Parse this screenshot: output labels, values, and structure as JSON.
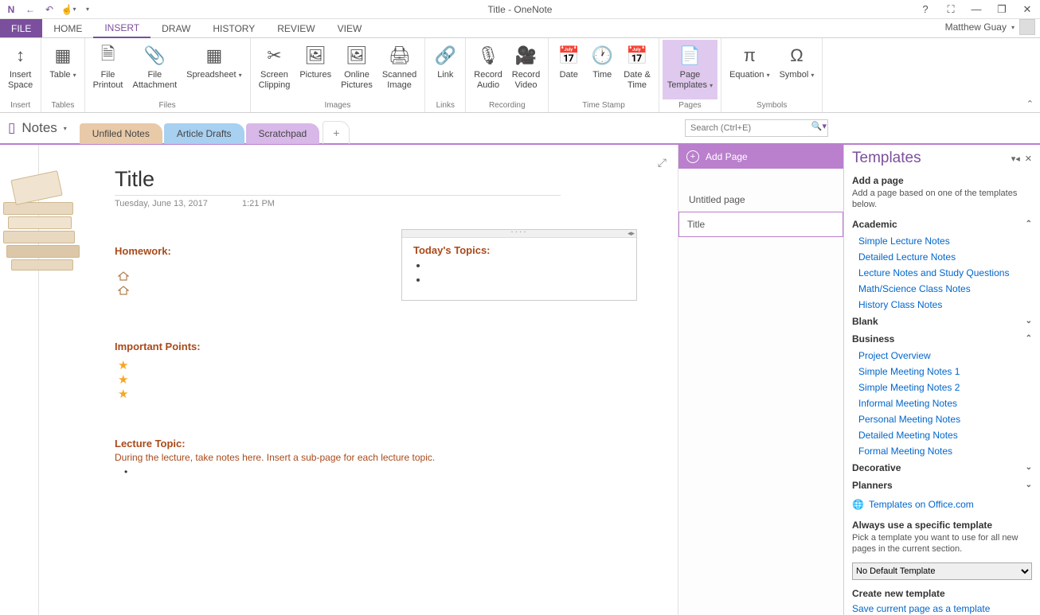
{
  "titlebar": {
    "title": "Title - OneNote"
  },
  "tabs": {
    "file": "FILE",
    "items": [
      "HOME",
      "INSERT",
      "DRAW",
      "HISTORY",
      "REVIEW",
      "VIEW"
    ],
    "activeIndex": 1,
    "user": "Matthew Guay"
  },
  "ribbon": {
    "groups": [
      {
        "label": "Insert",
        "items": [
          {
            "label": "Insert\nSpace"
          }
        ]
      },
      {
        "label": "Tables",
        "items": [
          {
            "label": "Table",
            "dd": true
          }
        ]
      },
      {
        "label": "Files",
        "items": [
          {
            "label": "File\nPrintout"
          },
          {
            "label": "File\nAttachment"
          },
          {
            "label": "Spreadsheet",
            "dd": true
          }
        ]
      },
      {
        "label": "Images",
        "items": [
          {
            "label": "Screen\nClipping"
          },
          {
            "label": "Pictures"
          },
          {
            "label": "Online\nPictures"
          },
          {
            "label": "Scanned\nImage"
          }
        ]
      },
      {
        "label": "Links",
        "items": [
          {
            "label": "Link"
          }
        ]
      },
      {
        "label": "Recording",
        "items": [
          {
            "label": "Record\nAudio"
          },
          {
            "label": "Record\nVideo"
          }
        ]
      },
      {
        "label": "Time Stamp",
        "items": [
          {
            "label": "Date"
          },
          {
            "label": "Time"
          },
          {
            "label": "Date &\nTime"
          }
        ]
      },
      {
        "label": "Pages",
        "items": [
          {
            "label": "Page\nTemplates",
            "dd": true,
            "active": true
          }
        ]
      },
      {
        "label": "Symbols",
        "items": [
          {
            "label": "Equation",
            "dd": true
          },
          {
            "label": "Symbol",
            "dd": true
          }
        ]
      }
    ]
  },
  "ribbon_icons": [
    "↕",
    "▦",
    "🗎",
    "📎",
    "▦",
    "✂",
    "🖼",
    "🖼",
    "🖨",
    "🔗",
    "🎙",
    "🎥",
    "📅",
    "🕐",
    "📅",
    "📄",
    "π",
    "Ω"
  ],
  "workspace": {
    "notebook": "Notes",
    "sections": [
      "Unfiled Notes",
      "Article Drafts",
      "Scratchpad"
    ],
    "search_placeholder": "Search (Ctrl+E)"
  },
  "page": {
    "title": "Title",
    "date": "Tuesday, June 13, 2017",
    "time": "1:21 PM",
    "homework_head": "Homework:",
    "important_head": "Important Points:",
    "lecture_head": "Lecture Topic:",
    "lecture_body": "During the lecture, take notes here.  Insert a sub-page for each lecture topic.",
    "topics_head": "Today's Topics:"
  },
  "pagesPanel": {
    "add": "Add Page",
    "items": [
      "Untitled page",
      "Title"
    ],
    "selectedIndex": 1
  },
  "templates": {
    "title": "Templates",
    "addPage": "Add a page",
    "addDesc": "Add a page based on one of the templates below.",
    "cats": {
      "academic": {
        "label": "Academic",
        "open": true,
        "items": [
          "Simple Lecture Notes",
          "Detailed Lecture Notes",
          "Lecture Notes and Study Questions",
          "Math/Science Class Notes",
          "History Class Notes"
        ]
      },
      "blank": {
        "label": "Blank",
        "open": false
      },
      "business": {
        "label": "Business",
        "open": true,
        "items": [
          "Project Overview",
          "Simple Meeting Notes 1",
          "Simple Meeting Notes 2",
          "Informal Meeting Notes",
          "Personal Meeting Notes",
          "Detailed Meeting Notes",
          "Formal Meeting Notes"
        ]
      },
      "decorative": {
        "label": "Decorative",
        "open": false
      },
      "planners": {
        "label": "Planners",
        "open": false
      }
    },
    "officeLink": "Templates on Office.com",
    "alwaysHead": "Always use a specific template",
    "alwaysDesc": "Pick a template you want to use for all new pages in the current section.",
    "defaultOption": "No Default Template",
    "createHead": "Create new template",
    "saveLink": "Save current page as a template"
  }
}
